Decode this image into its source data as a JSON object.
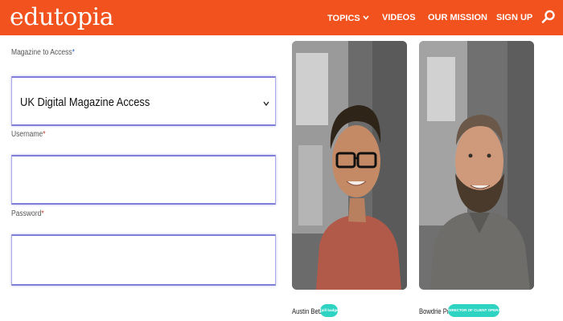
{
  "header": {
    "logo": "edutopia",
    "nav": {
      "topics": "TOPICS",
      "videos": "VIDEOS",
      "mission": "OUR MISSION",
      "signup": "SIGN UP"
    },
    "icons": {
      "search": "search-icon",
      "topics_chevron": "chevron-down-icon"
    },
    "bg_color": "#f2521e"
  },
  "form": {
    "magazine_label": "Magazine to Access",
    "magazine_value": "UK Digital Magazine Access",
    "username_label": "Username",
    "username_value": "",
    "password_label": "Password",
    "password_value": "",
    "required_marker": "*"
  },
  "staff": [
    {
      "name": "Austin Betzer",
      "role_badge": "[pill badge, text illegible]"
    },
    {
      "name": "Bowdrie Price",
      "role_badge": "DIRECTOR OF CLIENT OPERATIONS"
    }
  ],
  "colors": {
    "accent": "#f2521e",
    "badge": "#2fd3c2",
    "field_border": "#7f7fd9"
  }
}
